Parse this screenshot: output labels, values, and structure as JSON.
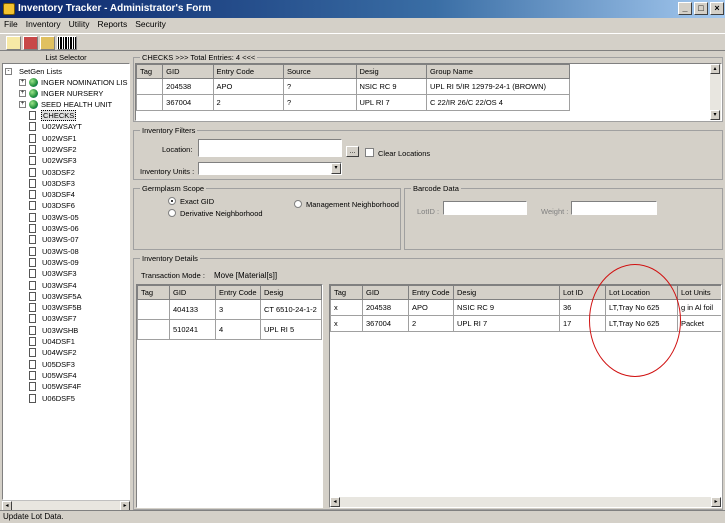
{
  "window": {
    "title": "Inventory Tracker - Administrator's Form"
  },
  "menu": [
    "File",
    "Inventory",
    "Utility",
    "Reports",
    "Security"
  ],
  "toolbar": {
    "icons": [
      "new-icon",
      "save-icon",
      "open-icon",
      "barcode-icon"
    ]
  },
  "left_panel": {
    "header": "List Selector",
    "root": "SetGen Lists",
    "groups": [
      "INGER NOMINATION LIS",
      "INGER NURSERY",
      "SEED HEALTH UNIT"
    ],
    "lists": [
      "CHECKS",
      "U02WSAYT",
      "U02WSF1",
      "U02WSF2",
      "U02WSF3",
      "U03DSF2",
      "U03DSF3",
      "U03DSF4",
      "U03DSF6",
      "U03WS-05",
      "U03WS-06",
      "U03WS-07",
      "U03WS-08",
      "U03WS-09",
      "U03WSF3",
      "U03WSF4",
      "U03WSF5A",
      "U03WSF5B",
      "U03WSF7",
      "U03WSHB",
      "U04DSF1",
      "U04WSF2",
      "U05DSF3",
      "U05WSF4",
      "U05WSF4F",
      "U06DSF5"
    ],
    "selected": "CHECKS"
  },
  "checks": {
    "header": "CHECKS >>> Total Entries: 4 <<<",
    "columns": [
      "Tag",
      "GID",
      "Entry Code",
      "Source",
      "Desig",
      "Group Name"
    ],
    "rows": [
      [
        "",
        "204538",
        "APO",
        "?",
        "NSIC RC 9",
        "UPL RI 5/IR 12979-24-1 (BROWN)"
      ],
      [
        "",
        "367004",
        "2",
        "?",
        "UPL RI 7",
        "C 22/IR 26/C 22/OS 4"
      ]
    ]
  },
  "inventory_filters": {
    "title": "Inventory Filters",
    "location_label": "Location:",
    "location_value": "",
    "browse_button": "...",
    "clear_label": "Clear Locations",
    "units_label": "Inventory Units :",
    "units_value": ""
  },
  "germplasm_scope": {
    "title": "Germplasm Scope",
    "options": [
      "Exact GID",
      "Derivative Neighborhood",
      "Management Neighborhood"
    ],
    "selected": "Exact GID"
  },
  "barcode": {
    "title": "Barcode Data",
    "lotid_label": "LotID :",
    "lotid_value": "",
    "weight_label": "Weight :",
    "weight_value": ""
  },
  "inventory_details": {
    "title": "Inventory Details",
    "transaction_label": "Transaction Mode :",
    "transaction_value": "Move [Material[s]]",
    "left_columns": [
      "Tag",
      "GID",
      "Entry Code",
      "Desig"
    ],
    "left_rows": [
      [
        "",
        "404133",
        "3",
        "CT 6510-24-1-2"
      ],
      [
        "",
        "510241",
        "4",
        "UPL RI 5"
      ]
    ],
    "right_columns": [
      "Tag",
      "GID",
      "Entry Code",
      "Desig",
      "Lot ID",
      "Lot Location",
      "Lot Units"
    ],
    "right_rows": [
      [
        "x",
        "204538",
        "APO",
        "NSIC RC 9",
        "36",
        "LT,Tray No 625",
        "g in Al foil"
      ],
      [
        "x",
        "367004",
        "2",
        "UPL RI 7",
        "17",
        "LT,Tray No 625",
        "Packet"
      ]
    ]
  },
  "status": "Update Lot Data.",
  "colors": {
    "titlebar": "#0a246a",
    "annotation": "#d01010"
  }
}
